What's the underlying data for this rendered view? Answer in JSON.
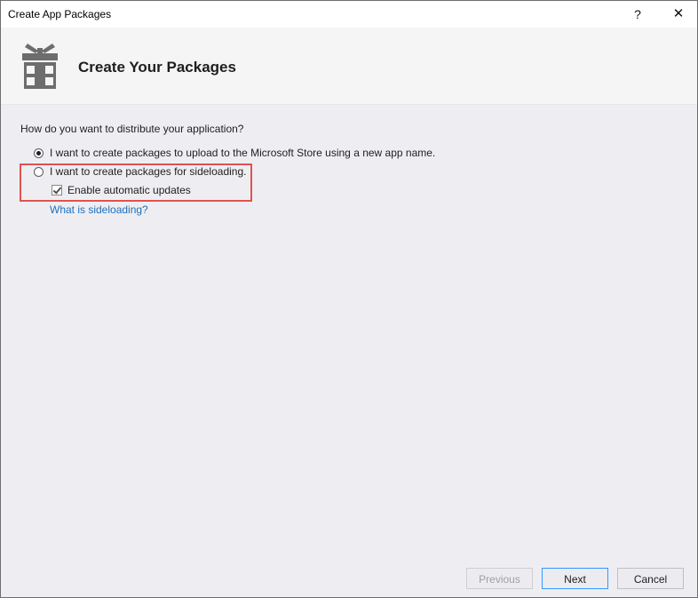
{
  "window": {
    "title": "Create App Packages",
    "help_glyph": "?",
    "close_glyph": "✕"
  },
  "header": {
    "icon": "gift-package-icon",
    "title": "Create Your Packages"
  },
  "main": {
    "question": "How do you want to distribute your application?",
    "options": [
      {
        "label": "I want to create packages to upload to the Microsoft Store using a new app name.",
        "selected": true
      },
      {
        "label": "I want to create packages for sideloading.",
        "selected": false
      }
    ],
    "auto_updates": {
      "label": "Enable automatic updates",
      "checked": true
    },
    "sideloading_link": "What is sideloading?"
  },
  "footer": {
    "previous": "Previous",
    "next": "Next",
    "cancel": "Cancel"
  },
  "colors": {
    "highlight_border": "#e0524f",
    "link": "#1f6fbf",
    "primary_border": "#3399ff"
  }
}
